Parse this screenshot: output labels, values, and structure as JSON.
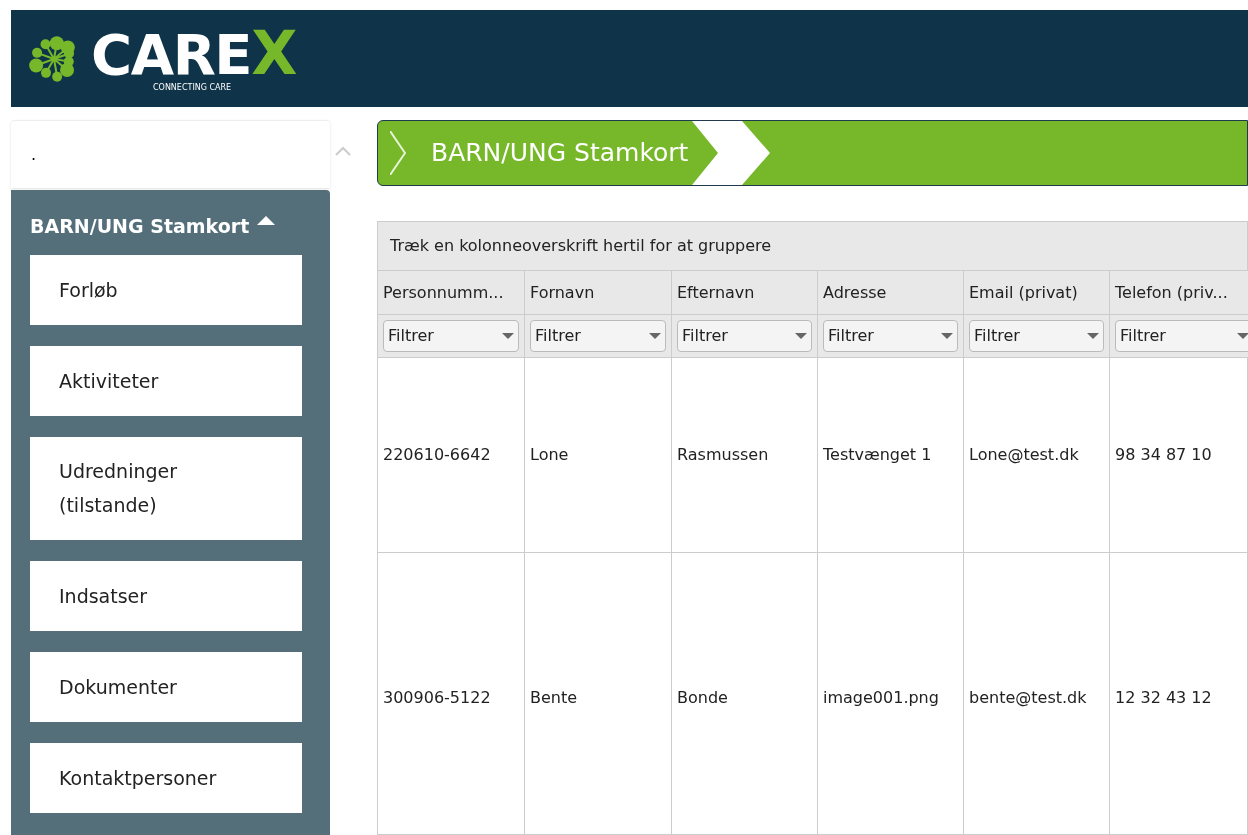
{
  "logo": {
    "name": "CARE",
    "mark": "X",
    "tagline": "CONNECTING CARE"
  },
  "sidebar": {
    "top_text": ".",
    "section": {
      "title": "BARN/UNG Stamkort",
      "expanded": true,
      "items": [
        {
          "label": "Forløb"
        },
        {
          "label": "Aktiviteter"
        },
        {
          "label": "Udredninger (tilstande)"
        },
        {
          "label": "Indsatser"
        },
        {
          "label": "Dokumenter"
        },
        {
          "label": "Kontaktpersoner"
        }
      ]
    }
  },
  "banner": {
    "title": "BARN/UNG Stamkort"
  },
  "grid": {
    "group_hint": "Træk en kolonneoverskrift hertil for at gruppere",
    "columns": [
      {
        "label": "Personnumm...",
        "filter": "Filtrer"
      },
      {
        "label": "Fornavn",
        "filter": "Filtrer"
      },
      {
        "label": "Efternavn",
        "filter": "Filtrer"
      },
      {
        "label": "Adresse",
        "filter": "Filtrer"
      },
      {
        "label": "Email (privat)",
        "filter": "Filtrer"
      },
      {
        "label": "Telefon (priv...",
        "filter": "Filtrer"
      }
    ],
    "rows": [
      [
        "220610-6642",
        "Lone",
        "Rasmussen",
        "Testvænget 1",
        "Lone@test.dk",
        "98 34 87 10"
      ],
      [
        "300906-5122",
        "Bente",
        "Bonde",
        "image001.png",
        "bente@test.dk",
        "12 32 43 12"
      ]
    ]
  }
}
